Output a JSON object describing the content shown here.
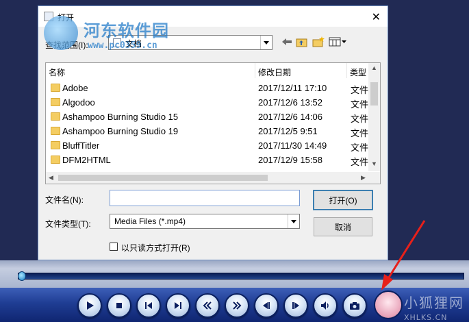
{
  "dialog": {
    "title": "打开",
    "close_glyph": "✕",
    "look_in_label": "查找范围(I):",
    "look_in_value": "文档",
    "columns": {
      "name": "名称",
      "date": "修改日期",
      "type": "类型"
    },
    "files": [
      {
        "name": "Adobe",
        "date": "2017/12/11 17:10",
        "type": "文件"
      },
      {
        "name": "Algodoo",
        "date": "2017/12/6 13:52",
        "type": "文件"
      },
      {
        "name": "Ashampoo Burning Studio 15",
        "date": "2017/12/6 14:06",
        "type": "文件"
      },
      {
        "name": "Ashampoo Burning Studio 19",
        "date": "2017/12/5 9:51",
        "type": "文件"
      },
      {
        "name": "BluffTitler",
        "date": "2017/11/30 14:49",
        "type": "文件"
      },
      {
        "name": "DFM2HTML",
        "date": "2017/12/9 15:58",
        "type": "文件"
      }
    ],
    "filename_label": "文件名(N):",
    "filename_value": "",
    "filetype_label": "文件类型(T):",
    "filetype_value": "Media Files (*.mp4)",
    "open_button": "打开(O)",
    "cancel_button": "取消",
    "readonly_label": "以只读方式打开(R)"
  },
  "watermarks": {
    "site_name": "河东软件园",
    "site_url": "www.pc0359.cn",
    "corner_name": "小狐狸网",
    "corner_url": "XHLKS.CN"
  },
  "player": {
    "seek_progress": 0.0
  },
  "colors": {
    "player_bg": "#212a54",
    "controlbar": "#1f3d93",
    "arrow": "#e8201a"
  }
}
